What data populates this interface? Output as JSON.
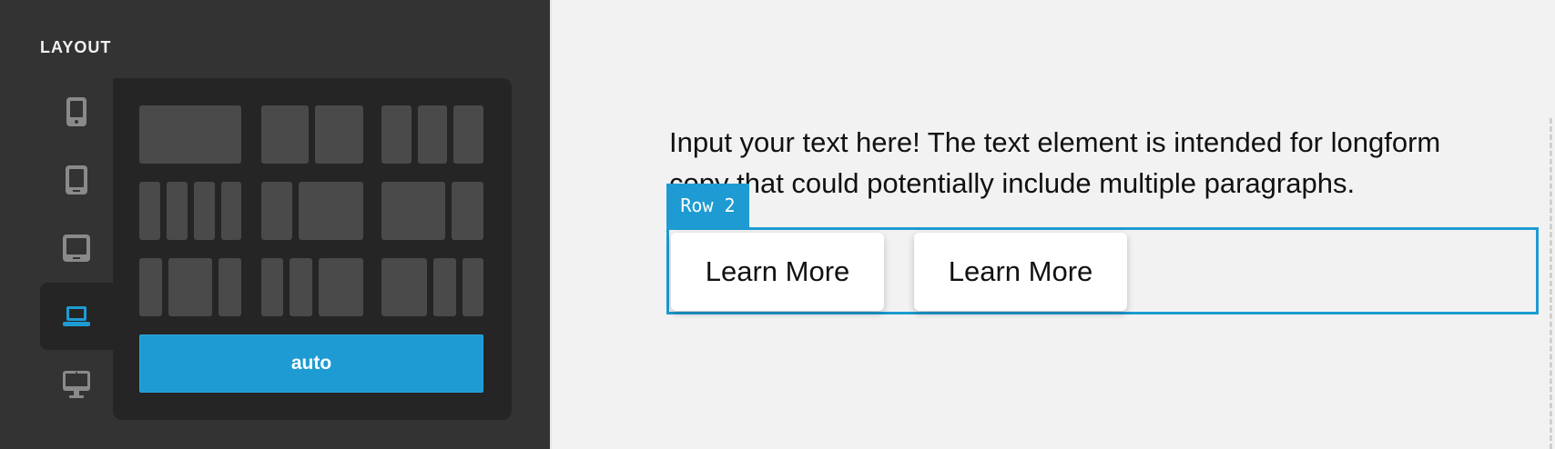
{
  "sidebar": {
    "title": "LAYOUT",
    "devices": [
      {
        "name": "phone-icon",
        "active": false
      },
      {
        "name": "tablet-icon",
        "active": false
      },
      {
        "name": "tablet-landscape-icon",
        "active": false
      },
      {
        "name": "laptop-icon",
        "active": true
      },
      {
        "name": "desktop-icon",
        "active": false
      }
    ],
    "layout_options": [
      "1",
      "1-1",
      "1-1-1",
      "1-1-1-1",
      "1-2",
      "2-1",
      "1-2-1",
      "1-1-2",
      "2-1-1"
    ],
    "auto_label": "auto"
  },
  "canvas": {
    "text_element": "Input your text here! The text element is intended for longform copy that could potentially include multiple paragraphs.",
    "row_label": "Row 2",
    "buttons": [
      "Learn More",
      "Learn More"
    ]
  },
  "colors": {
    "accent": "#1e9bd2",
    "sidebar_bg": "#333333",
    "panel_bg": "#252525",
    "cell": "#4a4a4a",
    "canvas_bg": "#f2f2f2",
    "icon": "#8a8a8a"
  }
}
